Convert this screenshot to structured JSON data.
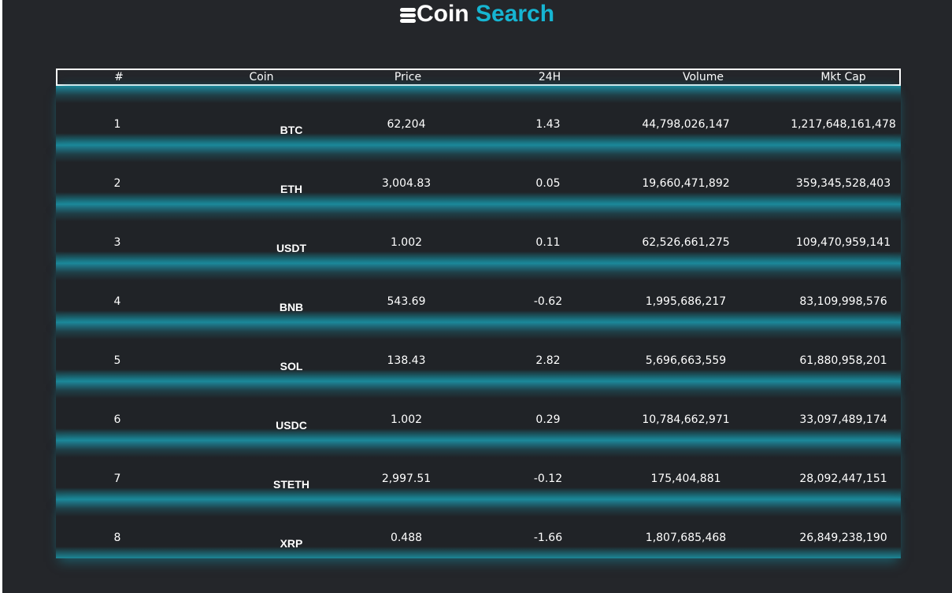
{
  "app": {
    "title_part1": "Coin",
    "title_part2": "Search",
    "logo_icon": "coin-stack-icon",
    "accent_color": "#16b5d2"
  },
  "table": {
    "headers": [
      "#",
      "Coin",
      "Price",
      "24H",
      "Volume",
      "Mkt Cap"
    ],
    "rows": [
      {
        "rank": "1",
        "coin": "BTC",
        "price": "62,204",
        "change": "1.43",
        "volume": "44,798,026,147",
        "cap": "1,217,648,161,478"
      },
      {
        "rank": "2",
        "coin": "ETH",
        "price": "3,004.83",
        "change": "0.05",
        "volume": "19,660,471,892",
        "cap": "359,345,528,403"
      },
      {
        "rank": "3",
        "coin": "USDT",
        "price": "1.002",
        "change": "0.11",
        "volume": "62,526,661,275",
        "cap": "109,470,959,141"
      },
      {
        "rank": "4",
        "coin": "BNB",
        "price": "543.69",
        "change": "-0.62",
        "volume": "1,995,686,217",
        "cap": "83,109,998,576"
      },
      {
        "rank": "5",
        "coin": "SOL",
        "price": "138.43",
        "change": "2.82",
        "volume": "5,696,663,559",
        "cap": "61,880,958,201"
      },
      {
        "rank": "6",
        "coin": "USDC",
        "price": "1.002",
        "change": "0.29",
        "volume": "10,784,662,971",
        "cap": "33,097,489,174"
      },
      {
        "rank": "7",
        "coin": "STETH",
        "price": "2,997.51",
        "change": "-0.12",
        "volume": "175,404,881",
        "cap": "28,092,447,151"
      },
      {
        "rank": "8",
        "coin": "XRP",
        "price": "0.488",
        "change": "-1.66",
        "volume": "1,807,685,468",
        "cap": "26,849,238,190"
      }
    ]
  }
}
